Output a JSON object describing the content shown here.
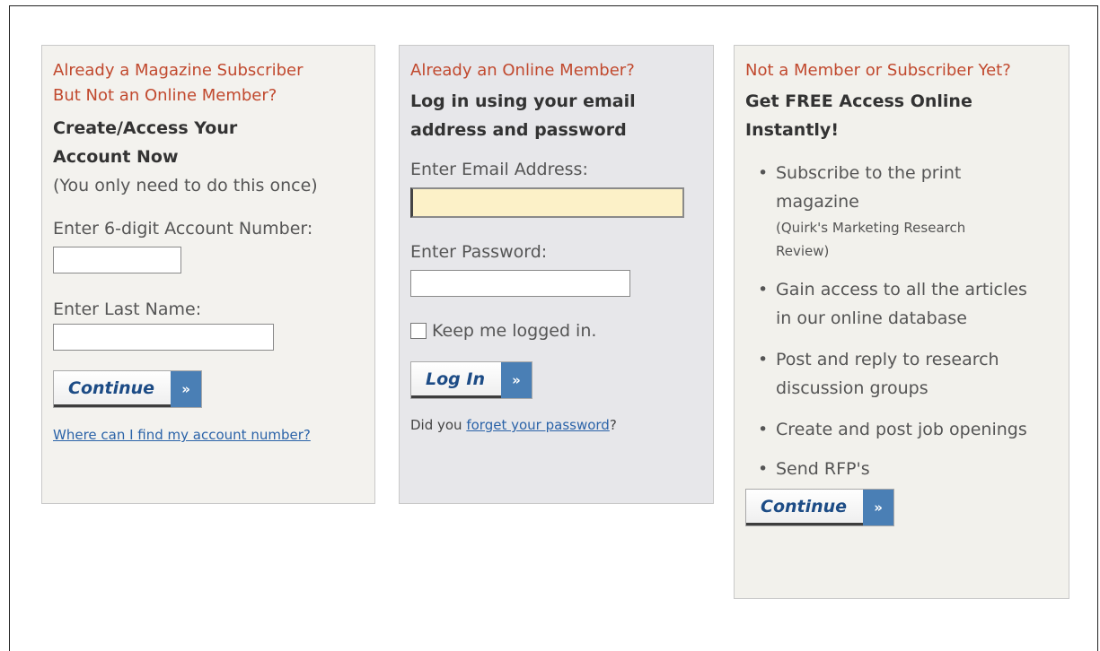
{
  "subscriber": {
    "kicker_line1": "Already a Magazine Subscriber",
    "kicker_line2": "But Not an Online Member?",
    "heading_line1": "Create/Access Your",
    "heading_line2": "Account Now",
    "note": "(You only need to do this once)",
    "account_label": "Enter 6-digit Account Number:",
    "account_value": "",
    "lastname_label": "Enter Last Name:",
    "lastname_value": "",
    "continue_label": "Continue",
    "help_link": "Where can I find my account number?"
  },
  "member": {
    "kicker": "Already an Online Member?",
    "heading_line1": "Log in using your email",
    "heading_line2": "address and password",
    "email_label": "Enter Email Address:",
    "email_value": "",
    "password_label": "Enter Password:",
    "password_value": "",
    "keep_logged_in": "Keep me logged in.",
    "keep_logged_in_checked": false,
    "login_label": "Log In",
    "forgot_prefix": "Did you ",
    "forgot_link": "forget your password",
    "forgot_suffix": "?"
  },
  "join": {
    "kicker": "Not a Member or Subscriber Yet?",
    "heading_line1": "Get FREE Access Online",
    "heading_line2": "Instantly!",
    "benefits": [
      {
        "line1": "Subscribe to the print",
        "line2": "magazine",
        "sub1": "(Quirk's Marketing Research",
        "sub2": "Review)"
      },
      {
        "line1": "Gain access to all the articles",
        "line2": "in our online database"
      },
      {
        "line1": "Post and reply to research",
        "line2": "discussion groups"
      },
      {
        "line1": "Create and post job openings"
      },
      {
        "line1": "Send RFP's"
      }
    ],
    "continue_label": "Continue"
  },
  "icons": {
    "button_arrow": "double-chevron-right-icon",
    "bullet": "bullet-dot"
  },
  "colors": {
    "kicker": "#c1492e",
    "button_text": "#1d4c86",
    "button_arrow_bg": "#4a7fb5",
    "link": "#2b63a8",
    "focused_input_bg": "#fcf1c8"
  }
}
